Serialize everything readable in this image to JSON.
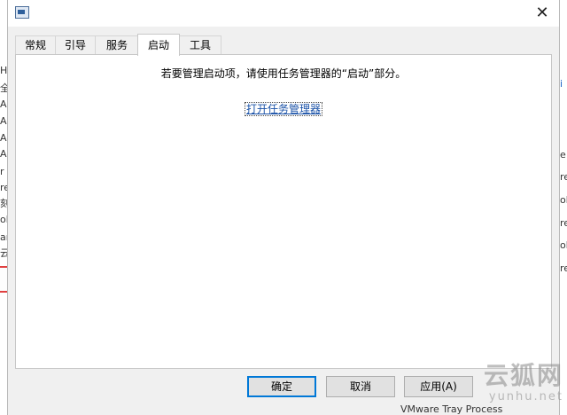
{
  "dialog": {
    "tabs": [
      "常规",
      "引导",
      "服务",
      "启动",
      "工具"
    ],
    "active_tab": 3,
    "info_text": "若要管理启动项，请使用任务管理器的“启动”部分。",
    "link_text": "打开任务管理器",
    "buttons": {
      "ok": "确定",
      "cancel": "取消",
      "apply": "应用(A)"
    },
    "close_glyph": "✕"
  },
  "background": {
    "left_fragments": [
      "H",
      "全",
      "A",
      "A",
      "A",
      "A",
      "r",
      "re",
      "刻",
      "ob",
      "ar",
      "云"
    ],
    "right_fragments": [
      "e",
      "re",
      "ob",
      "re",
      "ob",
      "re"
    ],
    "bottom_text": "VMware Tray Process"
  },
  "watermark": {
    "main": "云狐网",
    "sub": "yunhu.net"
  }
}
